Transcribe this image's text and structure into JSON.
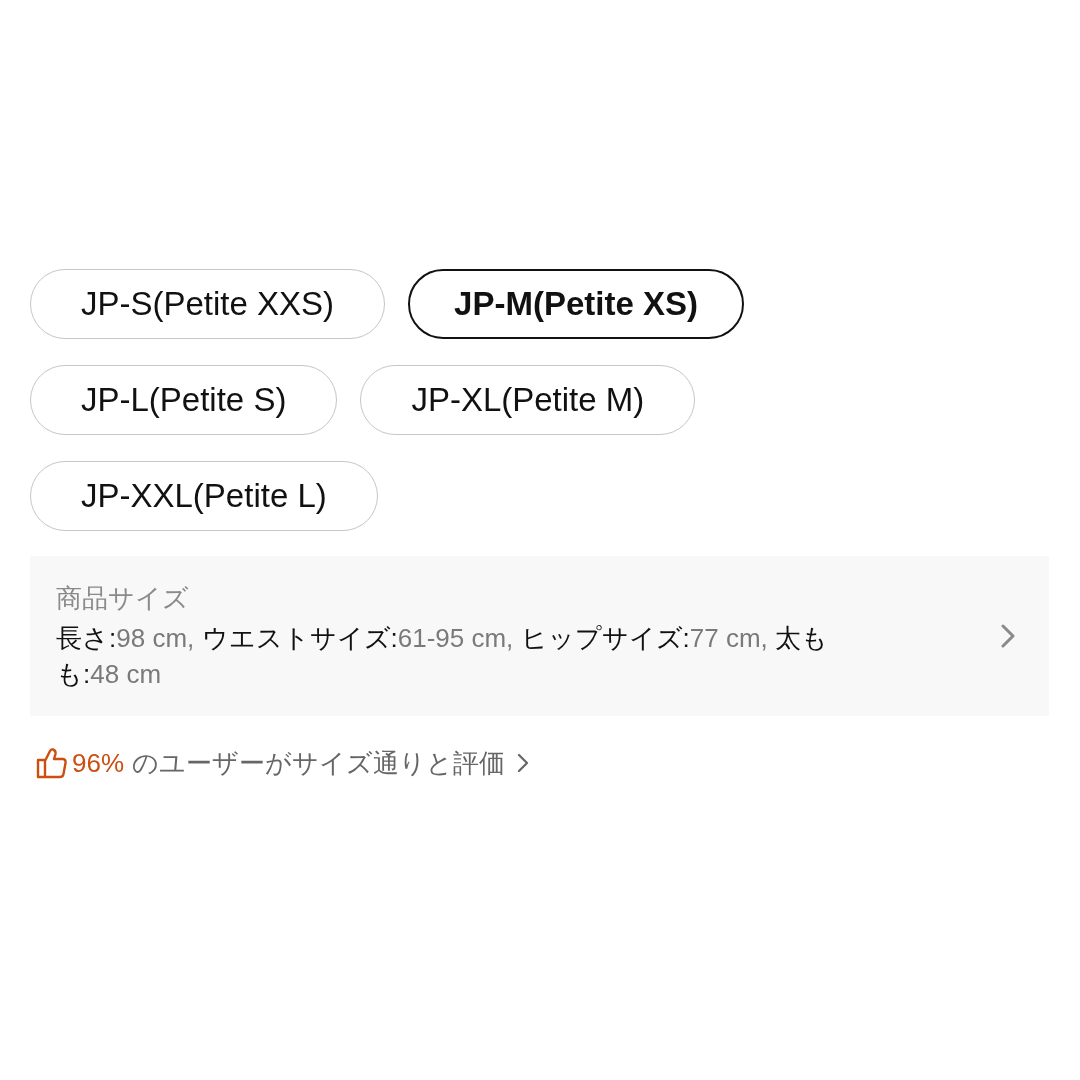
{
  "size_options": [
    {
      "label": "JP-S(Petite XXS)",
      "selected": false
    },
    {
      "label": "JP-M(Petite XS)",
      "selected": true
    },
    {
      "label": "JP-L(Petite S)",
      "selected": false
    },
    {
      "label": "JP-XL(Petite M)",
      "selected": false
    },
    {
      "label": "JP-XXL(Petite L)",
      "selected": false
    }
  ],
  "size_panel": {
    "title": "商品サイズ",
    "measurements": [
      {
        "label": "長さ:",
        "value": "98 cm,"
      },
      {
        "label": "ウエストサイズ:",
        "value": "61-95 cm,"
      },
      {
        "label": "ヒップサイズ:",
        "value": "77 cm,"
      },
      {
        "label": "太もも:",
        "value": "48 cm"
      }
    ]
  },
  "fit_rating": {
    "percent": "96%",
    "text": "のユーザーがサイズ通りと評価"
  }
}
